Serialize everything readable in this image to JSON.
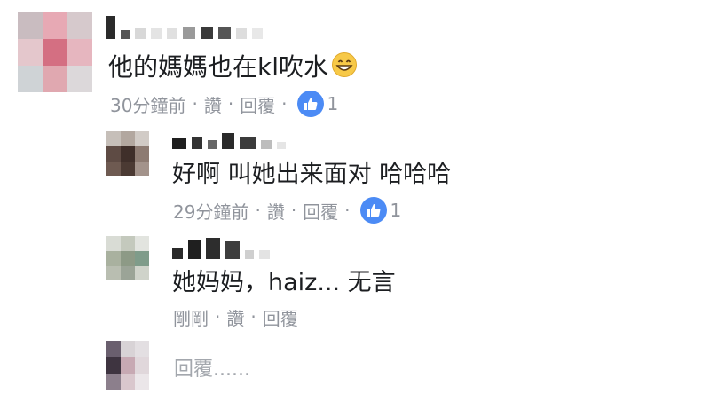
{
  "comments": [
    {
      "text": "他的媽媽也在kl吹水",
      "time": "30分鐘前",
      "like_label": "讚",
      "reply_label": "回覆",
      "likes": "1",
      "emoji": "grinning-face-emoji"
    },
    {
      "text": "好啊 叫她出来面对 哈哈哈",
      "time": "29分鐘前",
      "like_label": "讚",
      "reply_label": "回覆",
      "likes": "1"
    },
    {
      "text": "她妈妈，haiz... 无言",
      "time": "剛剛",
      "like_label": "讚",
      "reply_label": "回覆"
    }
  ],
  "reply_box": {
    "placeholder": "回覆......"
  },
  "colors": {
    "meta_gray": "#90949c",
    "like_blue": "#4c8bf5",
    "text": "#1c1e21"
  },
  "icons": [
    "thumbs-up-icon",
    "grinning-face-emoji"
  ]
}
